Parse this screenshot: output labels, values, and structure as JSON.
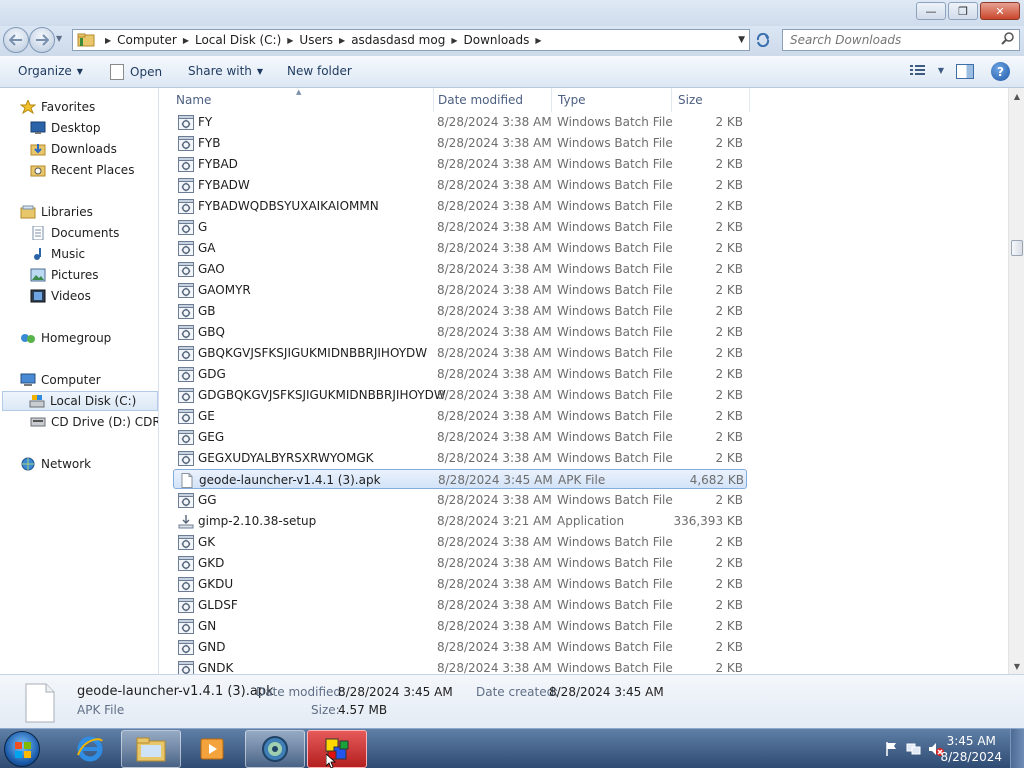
{
  "window": {
    "controls": {
      "minimize": "—",
      "maximize": "❐",
      "close": "✕"
    }
  },
  "address": {
    "crumbs": [
      "Computer",
      "Local Disk (C:)",
      "Users",
      "asdasdasd mog",
      "Downloads"
    ],
    "search_placeholder": "Search Downloads"
  },
  "toolbar": {
    "organize": "Organize",
    "open": "Open",
    "share_with": "Share with",
    "new_folder": "New folder"
  },
  "nav": {
    "favorites": "Favorites",
    "desktop": "Desktop",
    "downloads": "Downloads",
    "recent_places": "Recent Places",
    "libraries": "Libraries",
    "documents": "Documents",
    "music": "Music",
    "pictures": "Pictures",
    "videos": "Videos",
    "homegroup": "Homegroup",
    "computer": "Computer",
    "local_disk": "Local Disk (C:)",
    "cd_drive": "CD Drive (D:) CDROM",
    "network": "Network"
  },
  "columns": {
    "name": "Name",
    "date": "Date modified",
    "type": "Type",
    "size": "Size"
  },
  "files": [
    {
      "name": "FY",
      "date": "8/28/2024 3:38 AM",
      "type": "Windows Batch File",
      "size": "2 KB",
      "icon": "batch-file-icon"
    },
    {
      "name": "FYB",
      "date": "8/28/2024 3:38 AM",
      "type": "Windows Batch File",
      "size": "2 KB",
      "icon": "batch-file-icon"
    },
    {
      "name": "FYBAD",
      "date": "8/28/2024 3:38 AM",
      "type": "Windows Batch File",
      "size": "2 KB",
      "icon": "batch-file-icon"
    },
    {
      "name": "FYBADW",
      "date": "8/28/2024 3:38 AM",
      "type": "Windows Batch File",
      "size": "2 KB",
      "icon": "batch-file-icon"
    },
    {
      "name": "FYBADWQDBSYUXAIKAIOMMN",
      "date": "8/28/2024 3:38 AM",
      "type": "Windows Batch File",
      "size": "2 KB",
      "icon": "batch-file-icon"
    },
    {
      "name": "G",
      "date": "8/28/2024 3:38 AM",
      "type": "Windows Batch File",
      "size": "2 KB",
      "icon": "batch-file-icon"
    },
    {
      "name": "GA",
      "date": "8/28/2024 3:38 AM",
      "type": "Windows Batch File",
      "size": "2 KB",
      "icon": "batch-file-icon"
    },
    {
      "name": "GAO",
      "date": "8/28/2024 3:38 AM",
      "type": "Windows Batch File",
      "size": "2 KB",
      "icon": "batch-file-icon"
    },
    {
      "name": "GAOMYR",
      "date": "8/28/2024 3:38 AM",
      "type": "Windows Batch File",
      "size": "2 KB",
      "icon": "batch-file-icon"
    },
    {
      "name": "GB",
      "date": "8/28/2024 3:38 AM",
      "type": "Windows Batch File",
      "size": "2 KB",
      "icon": "batch-file-icon"
    },
    {
      "name": "GBQ",
      "date": "8/28/2024 3:38 AM",
      "type": "Windows Batch File",
      "size": "2 KB",
      "icon": "batch-file-icon"
    },
    {
      "name": "GBQKGVJSFKSJIGUKMIDNBBRJIHOYDW",
      "date": "8/28/2024 3:38 AM",
      "type": "Windows Batch File",
      "size": "2 KB",
      "icon": "batch-file-icon"
    },
    {
      "name": "GDG",
      "date": "8/28/2024 3:38 AM",
      "type": "Windows Batch File",
      "size": "2 KB",
      "icon": "batch-file-icon"
    },
    {
      "name": "GDGBQKGVJSFKSJIGUKMIDNBBRJIHOYDW",
      "date": "8/28/2024 3:38 AM",
      "type": "Windows Batch File",
      "size": "2 KB",
      "icon": "batch-file-icon"
    },
    {
      "name": "GE",
      "date": "8/28/2024 3:38 AM",
      "type": "Windows Batch File",
      "size": "2 KB",
      "icon": "batch-file-icon"
    },
    {
      "name": "GEG",
      "date": "8/28/2024 3:38 AM",
      "type": "Windows Batch File",
      "size": "2 KB",
      "icon": "batch-file-icon"
    },
    {
      "name": "GEGXUDYALBYRSXRWYOMGK",
      "date": "8/28/2024 3:38 AM",
      "type": "Windows Batch File",
      "size": "2 KB",
      "icon": "batch-file-icon"
    },
    {
      "name": "geode-launcher-v1.4.1 (3).apk",
      "date": "8/28/2024 3:45 AM",
      "type": "APK File",
      "size": "4,682 KB",
      "icon": "blank-file-icon",
      "selected": true
    },
    {
      "name": "GG",
      "date": "8/28/2024 3:38 AM",
      "type": "Windows Batch File",
      "size": "2 KB",
      "icon": "batch-file-icon"
    },
    {
      "name": "gimp-2.10.38-setup",
      "date": "8/28/2024 3:21 AM",
      "type": "Application",
      "size": "336,393 KB",
      "icon": "installer-icon"
    },
    {
      "name": "GK",
      "date": "8/28/2024 3:38 AM",
      "type": "Windows Batch File",
      "size": "2 KB",
      "icon": "batch-file-icon"
    },
    {
      "name": "GKD",
      "date": "8/28/2024 3:38 AM",
      "type": "Windows Batch File",
      "size": "2 KB",
      "icon": "batch-file-icon"
    },
    {
      "name": "GKDU",
      "date": "8/28/2024 3:38 AM",
      "type": "Windows Batch File",
      "size": "2 KB",
      "icon": "batch-file-icon"
    },
    {
      "name": "GLDSF",
      "date": "8/28/2024 3:38 AM",
      "type": "Windows Batch File",
      "size": "2 KB",
      "icon": "batch-file-icon"
    },
    {
      "name": "GN",
      "date": "8/28/2024 3:38 AM",
      "type": "Windows Batch File",
      "size": "2 KB",
      "icon": "batch-file-icon"
    },
    {
      "name": "GND",
      "date": "8/28/2024 3:38 AM",
      "type": "Windows Batch File",
      "size": "2 KB",
      "icon": "batch-file-icon"
    },
    {
      "name": "GNDK",
      "date": "8/28/2024 3:38 AM",
      "type": "Windows Batch File",
      "size": "2 KB",
      "icon": "batch-file-icon"
    }
  ],
  "details": {
    "name": "geode-launcher-v1.4.1 (3).apk",
    "type": "APK File",
    "date_modified_label": "Date modified:",
    "date_modified": "8/28/2024 3:45 AM",
    "date_created_label": "Date created:",
    "date_created": "8/28/2024 3:45 AM",
    "size_label": "Size:",
    "size": "4.57 MB"
  },
  "taskbar": {
    "time": "3:45 AM",
    "date": "8/28/2024"
  },
  "colors": {
    "accent": "#3a6fb0",
    "selection_border": "#84acdd",
    "muted_text": "#6d6d6d"
  }
}
